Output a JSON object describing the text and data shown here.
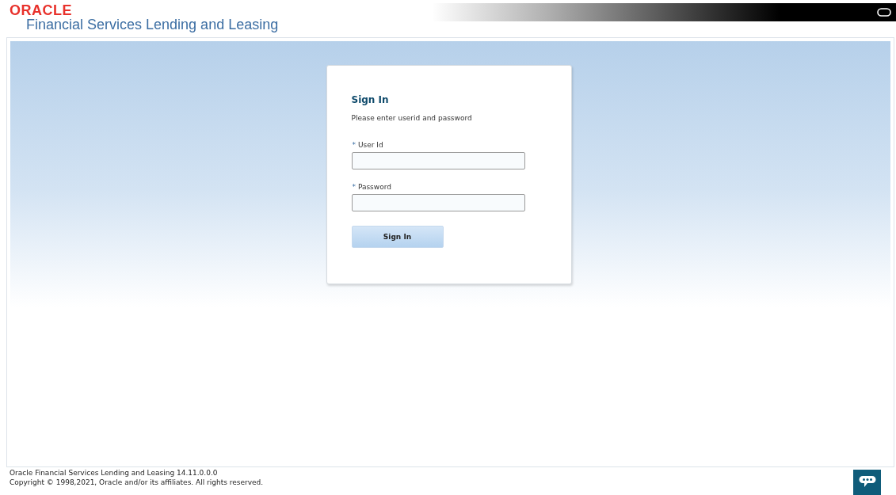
{
  "header": {
    "brand": "ORACLE",
    "product": "Financial Services Lending and Leasing"
  },
  "login": {
    "title": "Sign In",
    "instructions": "Please enter userid and password",
    "fields": [
      {
        "required_mark": "*",
        "label": "User Id"
      },
      {
        "required_mark": "*",
        "label": "Password"
      }
    ],
    "button": "Sign In"
  },
  "footer": {
    "version": "Oracle Financial Services Lending and Leasing 14.11.0.0.0",
    "copyright": "Copyright © 1998,2021, Oracle and/or its affiliates. All rights reserved."
  }
}
